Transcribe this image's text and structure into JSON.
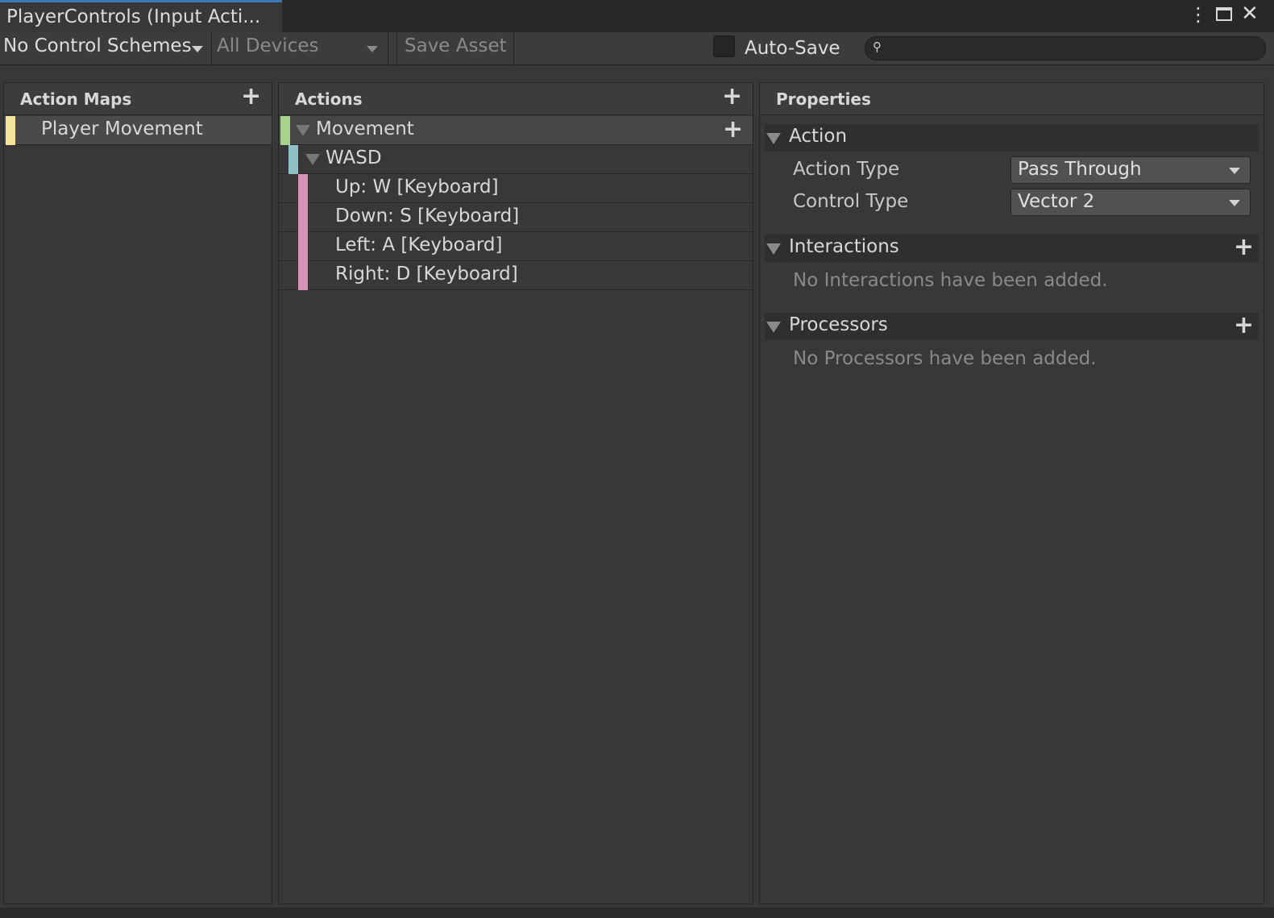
{
  "window": {
    "tab_title": "PlayerControls (Input Acti...",
    "menu_icon": "kebab-menu-icon",
    "maximize_icon": "maximize-icon",
    "close_icon": "close-icon"
  },
  "toolbar": {
    "control_scheme": "No Control Schemes",
    "devices": "All Devices",
    "save_asset": "Save Asset",
    "auto_save_label": "Auto-Save",
    "auto_save_checked": false,
    "search_value": "",
    "search_icon": "search-icon"
  },
  "action_maps": {
    "title": "Action Maps",
    "items": [
      {
        "label": "Player Movement",
        "color": "#f4e49a",
        "selected": true
      }
    ]
  },
  "actions": {
    "title": "Actions",
    "action": {
      "label": "Movement",
      "color": "#a9d18e"
    },
    "composite": {
      "label": "WASD",
      "color": "#8fc0c8"
    },
    "bindings": [
      {
        "label": "Up: W [Keyboard]",
        "color": "#d394b5"
      },
      {
        "label": "Down: S [Keyboard]",
        "color": "#d394b5"
      },
      {
        "label": "Left: A [Keyboard]",
        "color": "#d394b5"
      },
      {
        "label": "Right: D [Keyboard]",
        "color": "#d394b5"
      }
    ]
  },
  "properties": {
    "title": "Properties",
    "action_section": {
      "title": "Action",
      "action_type_label": "Action Type",
      "action_type_value": "Pass Through",
      "control_type_label": "Control Type",
      "control_type_value": "Vector 2"
    },
    "interactions": {
      "title": "Interactions",
      "empty_text": "No Interactions have been added."
    },
    "processors": {
      "title": "Processors",
      "empty_text": "No Processors have been added."
    }
  },
  "colors": {
    "background": "#383838",
    "tab_accent": "#3a79bb",
    "header": "#3c3c3c",
    "section_header": "#2f2f2f"
  }
}
